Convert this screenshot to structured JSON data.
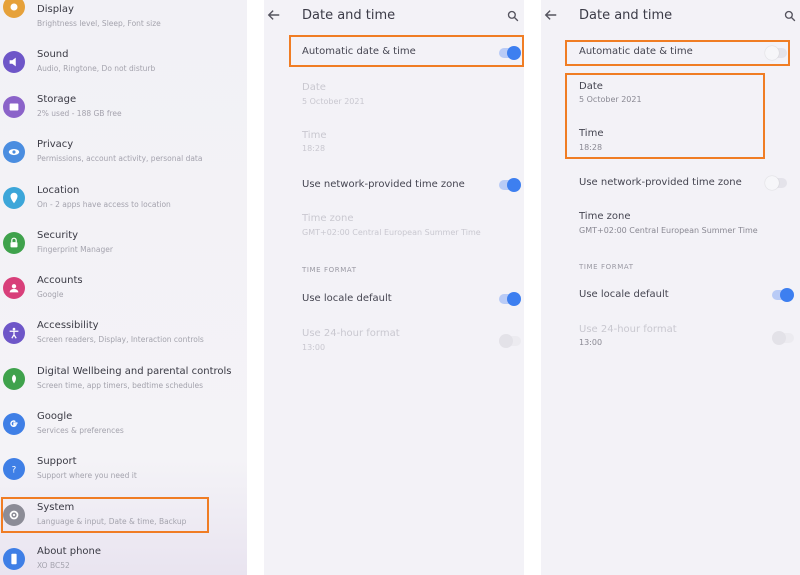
{
  "settings_list": {
    "items": [
      {
        "title": "Display",
        "subtitle": "Brightness level, Sleep, Font size",
        "icon": "display-icon",
        "color": "#e6a13a"
      },
      {
        "title": "Sound",
        "subtitle": "Audio, Ringtone, Do not disturb",
        "icon": "sound-icon",
        "color": "#6e56c8"
      },
      {
        "title": "Storage",
        "subtitle": "2% used - 188 GB free",
        "icon": "storage-icon",
        "color": "#8b63c9"
      },
      {
        "title": "Privacy",
        "subtitle": "Permissions, account activity, personal data",
        "icon": "privacy-icon",
        "color": "#4a8de0"
      },
      {
        "title": "Location",
        "subtitle": "On - 2 apps have access to location",
        "icon": "location-icon",
        "color": "#3ca6d9"
      },
      {
        "title": "Security",
        "subtitle": "Fingerprint Manager",
        "icon": "security-icon",
        "color": "#3fa24c"
      },
      {
        "title": "Accounts",
        "subtitle": "Google",
        "icon": "accounts-icon",
        "color": "#d83f7a"
      },
      {
        "title": "Accessibility",
        "subtitle": "Screen readers, Display, Interaction controls",
        "icon": "accessibility-icon",
        "color": "#6e56c8"
      },
      {
        "title": "Digital Wellbeing and parental controls",
        "subtitle": "Screen time, app timers, bedtime schedules",
        "icon": "wellbeing-icon",
        "color": "#3fa24c"
      },
      {
        "title": "Google",
        "subtitle": "Services & preferences",
        "icon": "google-icon",
        "color": "#3f7fe6"
      },
      {
        "title": "Support",
        "subtitle": "Support where you need it",
        "icon": "support-icon",
        "color": "#3f7fe6"
      },
      {
        "title": "System",
        "subtitle": "Language & input, Date & time, Backup",
        "icon": "system-icon",
        "color": "#8c8c96"
      },
      {
        "title": "About phone",
        "subtitle": "XO BC52",
        "icon": "about-phone-icon",
        "color": "#3f7fe6"
      }
    ]
  },
  "screen_before": {
    "title": "Date and time",
    "auto_datetime": {
      "label": "Automatic date & time",
      "on": true
    },
    "date": {
      "label": "Date",
      "value": "5 October 2021"
    },
    "time": {
      "label": "Time",
      "value": "18:28"
    },
    "network_timezone": {
      "label": "Use network-provided time zone",
      "on": true
    },
    "timezone": {
      "label": "Time zone",
      "value": "GMT+02:00 Central European Summer Time"
    },
    "section_time_format": "TIME FORMAT",
    "locale_default": {
      "label": "Use locale default",
      "on": true
    },
    "use_24h": {
      "label": "Use 24-hour format",
      "value": "13:00"
    }
  },
  "screen_after": {
    "title": "Date and time",
    "auto_datetime": {
      "label": "Automatic date & time",
      "on": false
    },
    "date": {
      "label": "Date",
      "value": "5 October 2021"
    },
    "time": {
      "label": "Time",
      "value": "18:28"
    },
    "network_timezone": {
      "label": "Use network-provided time zone",
      "on": false
    },
    "timezone": {
      "label": "Time zone",
      "value": "GMT+02:00 Central European Summer Time"
    },
    "section_time_format": "TIME FORMAT",
    "locale_default": {
      "label": "Use locale default",
      "on": true
    },
    "use_24h": {
      "label": "Use 24-hour format",
      "value": "13:00"
    }
  },
  "highlight_color": "#f07d24",
  "accent_color": "#3d7ff0"
}
